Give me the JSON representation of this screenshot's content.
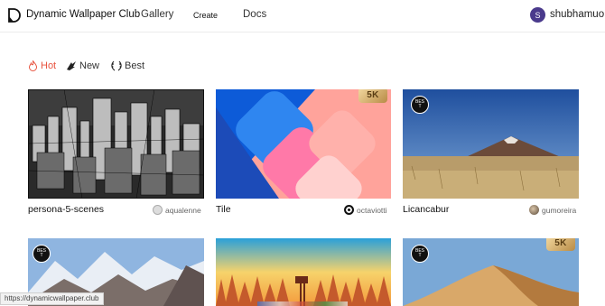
{
  "header": {
    "brand": "Dynamic Wallpaper Club",
    "nav": {
      "gallery": "Gallery",
      "create": "Create",
      "docs": "Docs"
    },
    "user": {
      "initial": "S",
      "name": "shubhamuo"
    }
  },
  "tabs": [
    {
      "label": "Hot",
      "active": true
    },
    {
      "label": "New",
      "active": false
    },
    {
      "label": "Best",
      "active": false
    }
  ],
  "cards": [
    {
      "title": "persona-5-scenes",
      "author": "aqualenne"
    },
    {
      "title": "Tile",
      "author": "octaviotti",
      "badge": "5K"
    },
    {
      "title": "Licancabur",
      "author": "gumoreira",
      "badge": "BEST"
    },
    {
      "title": "",
      "author": "",
      "badge": "BEST"
    },
    {
      "title": "",
      "author": ""
    },
    {
      "title": "",
      "author": "",
      "badge": "BEST",
      "badge2": "5K"
    }
  ],
  "status_url": "https://dynamicwallpaper.club",
  "colors": {
    "accent": "#e8533f",
    "avatar": "#4a3a8c"
  }
}
